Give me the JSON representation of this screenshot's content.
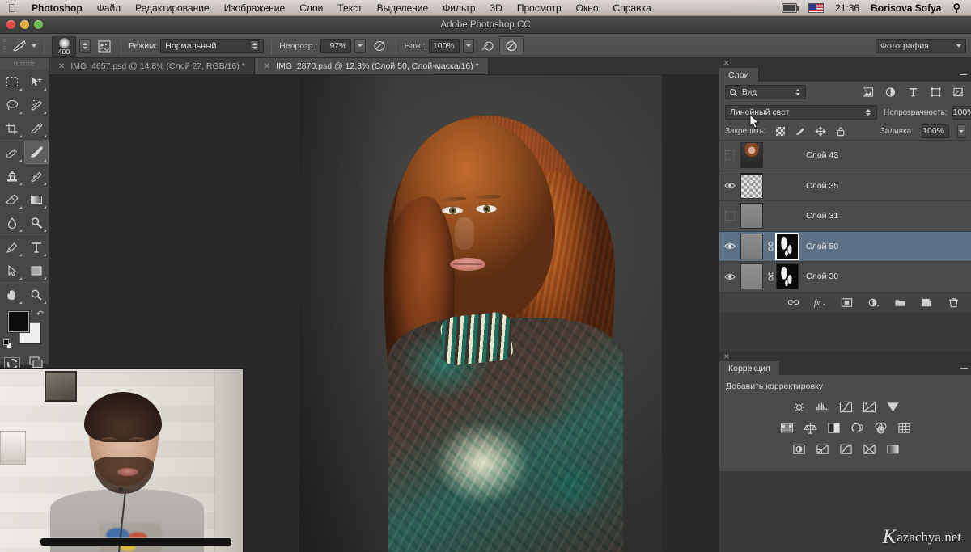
{
  "menubar": {
    "apple_icon": "apple-icon",
    "app_name": "Photoshop",
    "items": [
      "Файл",
      "Редактирование",
      "Изображение",
      "Слои",
      "Текст",
      "Выделение",
      "Фильтр",
      "3D",
      "Просмотр",
      "Окно",
      "Справка"
    ],
    "status": {
      "battery_icon": "battery-icon",
      "input_flag_icon": "us-flag-icon",
      "time": "21:36",
      "user": "Borisova Sofya",
      "search_icon": "search-icon"
    }
  },
  "titlebar": {
    "title": "Adobe Photoshop CC",
    "close_label": "close",
    "minimize_label": "minimize",
    "zoom_label": "zoom"
  },
  "options_bar": {
    "tool_icon": "brush-tool-icon",
    "tool_preset_caret": "chevron-down-icon",
    "brush_size": "400",
    "brush_panel_icon": "brush-panel-icon",
    "mode_label": "Режим:",
    "mode_value": "Нормальный",
    "opacity_label": "Непрозр.:",
    "opacity_value": "97%",
    "opacity_pressure_icon": "pressure-opacity-icon",
    "flow_label": "Наж.:",
    "flow_value": "100%",
    "airbrush_icon": "airbrush-icon",
    "flow_pressure_icon": "pressure-size-icon",
    "workspace_value": "Фотография"
  },
  "toolbox": {
    "tools": [
      {
        "name": "rectangular-marquee-tool",
        "selected": false
      },
      {
        "name": "move-tool",
        "selected": false
      },
      {
        "name": "lasso-tool",
        "selected": false
      },
      {
        "name": "quick-selection-tool",
        "selected": false
      },
      {
        "name": "crop-tool",
        "selected": false
      },
      {
        "name": "eyedropper-tool",
        "selected": false
      },
      {
        "name": "spot-healing-brush-tool",
        "selected": false
      },
      {
        "name": "brush-tool",
        "selected": true
      },
      {
        "name": "clone-stamp-tool",
        "selected": false
      },
      {
        "name": "history-brush-tool",
        "selected": false
      },
      {
        "name": "eraser-tool",
        "selected": false
      },
      {
        "name": "gradient-tool",
        "selected": false
      },
      {
        "name": "blur-tool",
        "selected": false
      },
      {
        "name": "dodge-tool",
        "selected": false
      },
      {
        "name": "pen-tool",
        "selected": false
      },
      {
        "name": "horizontal-type-tool",
        "selected": false
      },
      {
        "name": "path-selection-tool",
        "selected": false
      },
      {
        "name": "rectangle-tool",
        "selected": false
      },
      {
        "name": "hand-tool",
        "selected": false
      },
      {
        "name": "zoom-tool",
        "selected": false
      }
    ],
    "foreground_color": "#0b0b0b",
    "background_color": "#f0f0f0",
    "quick_mask_icon": "quick-mask-icon",
    "screen_mode_icon": "screen-mode-icon",
    "swap_colors_icon": "swap-colors-icon",
    "default_colors_icon": "default-colors-icon"
  },
  "document_tabs": [
    {
      "close_icon": "close-icon",
      "label": "IMG_4657.psd @ 14,8% (Слой 27, RGB/16) *",
      "active": false
    },
    {
      "close_icon": "close-icon",
      "label": "IMG_2870.psd @ 12,3% (Слой 50, Слой-маска/16) *",
      "active": true
    }
  ],
  "layers_panel": {
    "tab_label": "Слои",
    "panel_menu_icon": "panel-menu-icon",
    "close_icon": "close-icon",
    "filter": {
      "search_icon": "search-icon",
      "kind_value": "Вид",
      "icons": [
        "filter-pixel-icon",
        "filter-adjustment-icon",
        "filter-type-icon",
        "filter-shape-icon",
        "filter-smart-object-icon"
      ]
    },
    "blend_mode": "Линейный свет",
    "opacity_label": "Непрозрачность:",
    "opacity_value": "100%",
    "lock_label": "Закрепить:",
    "lock_icons": [
      "lock-transparent-pixels-icon",
      "lock-image-pixels-icon",
      "lock-position-icon",
      "lock-all-icon"
    ],
    "fill_label": "Заливка:",
    "fill_value": "100%",
    "layers": [
      {
        "name": "Слой 43",
        "visible": false,
        "thumb": "person",
        "has_mask": false,
        "selected": false
      },
      {
        "name": "Слой 35",
        "visible": true,
        "thumb": "transparent",
        "has_mask": false,
        "selected": false
      },
      {
        "name": "Слой 31",
        "visible": false,
        "thumb": "grey",
        "has_mask": false,
        "selected": false
      },
      {
        "name": "Слой 50",
        "visible": true,
        "thumb": "grey",
        "has_mask": true,
        "mask_selected": true,
        "selected": true
      },
      {
        "name": "Слой 30",
        "visible": true,
        "thumb": "greylt",
        "has_mask": true,
        "mask_selected": false,
        "selected": false
      }
    ],
    "footer_icons": [
      "link-layers-icon",
      "layer-style-fx-icon",
      "add-layer-mask-icon",
      "new-adjustment-layer-icon",
      "new-group-icon",
      "new-layer-icon",
      "delete-layer-icon"
    ]
  },
  "mini_panel": {
    "footer_icons": [
      "load-selection-icon",
      "apply-mask-icon",
      "toggle-mask-icon",
      "delete-mask-icon"
    ]
  },
  "corrections_panel": {
    "close_icon": "close-icon",
    "tab_label": "Коррекция",
    "panel_menu_icon": "panel-menu-icon",
    "title": "Добавить корректировку",
    "row1_icons": [
      "brightness-contrast-icon",
      "levels-icon",
      "curves-icon",
      "exposure-icon",
      "vibrance-icon"
    ],
    "row2_icons": [
      "hue-saturation-icon",
      "color-balance-icon",
      "black-white-icon",
      "photo-filter-icon",
      "channel-mixer-icon",
      "color-lookup-icon"
    ],
    "row3_icons": [
      "invert-icon",
      "posterize-icon",
      "threshold-icon",
      "selective-color-icon",
      "gradient-map-icon"
    ]
  },
  "canvas": {
    "document_name": "IMG_2870.psd",
    "image_alt": "portrait-photo-red-haired-woman"
  },
  "webcam": {
    "alt": "webcam-presenter-video"
  },
  "watermark": {
    "logo_letter": "K",
    "text": "azachya.net"
  },
  "colors": {
    "menubar_text": "#111111",
    "panel_bg": "#4b4b4b",
    "dock_bg": "#3a3a3a",
    "canvas_bg": "#292929",
    "selected_layer": "#5d7186",
    "text_primary": "#dcdcdc",
    "text_secondary": "#a9a9a9"
  }
}
